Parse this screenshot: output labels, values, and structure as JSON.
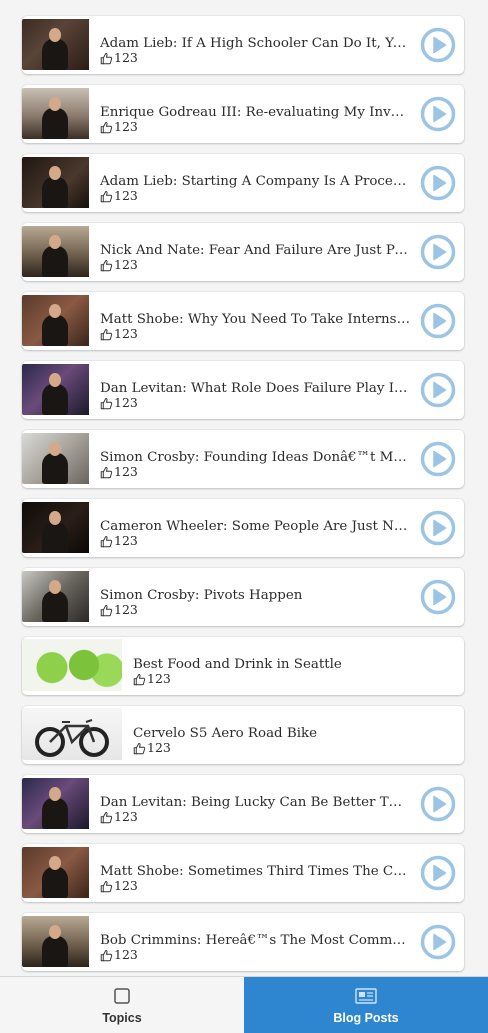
{
  "feed": {
    "items": [
      {
        "title": "Adam Lieb: If A High Schooler Can Do It, You ...",
        "likes": "123",
        "thumb": "t-dark-office",
        "type": "video"
      },
      {
        "title": "Enrique Godreau III: Re-evaluating My Invest...",
        "likes": "123",
        "thumb": "t-two-chairs",
        "type": "video"
      },
      {
        "title": "Adam Lieb: Starting A Company Is A Process ...",
        "likes": "123",
        "thumb": "t-dark-label",
        "type": "video"
      },
      {
        "title": "Nick And Nate: Fear And Failure Are Just Part...",
        "likes": "123",
        "thumb": "t-sofa",
        "type": "video"
      },
      {
        "title": "Matt Shobe: Why You Need To Take Internships",
        "likes": "123",
        "thumb": "t-brick",
        "type": "video"
      },
      {
        "title": "Dan Levitan: What Role Does Failure Play In Y...",
        "likes": "123",
        "thumb": "t-stage",
        "type": "video"
      },
      {
        "title": "Simon Crosby: Founding Ideas Donâ€™t Make ...",
        "likes": "123",
        "thumb": "t-bright",
        "type": "video"
      },
      {
        "title": "Cameron Wheeler: Some People Are Just Not ...",
        "likes": "123",
        "thumb": "t-black",
        "type": "video"
      },
      {
        "title": "Simon Crosby: Pivots Happen",
        "likes": "123",
        "thumb": "t-window",
        "type": "video"
      },
      {
        "title": "Best Food and Drink in Seattle",
        "likes": "123",
        "thumb": "t-limes",
        "type": "post"
      },
      {
        "title": "Cervelo S5 Aero Road Bike",
        "likes": "123",
        "thumb": "t-bike",
        "type": "post"
      },
      {
        "title": "Dan Levitan: Being Lucky Can Be Better Than ...",
        "likes": "123",
        "thumb": "t-stage",
        "type": "video"
      },
      {
        "title": "Matt Shobe: Sometimes Third Times The Char...",
        "likes": "123",
        "thumb": "t-brick",
        "type": "video"
      },
      {
        "title": "Bob Crimmins: Hereâ€™s The Most Common F...",
        "likes": "123",
        "thumb": "t-sofa",
        "type": "video"
      }
    ],
    "icons": {
      "like": "thumbs-up-icon",
      "play": "play-circle-icon"
    }
  },
  "tabbar": {
    "topics_label": "Topics",
    "blog_label": "Blog Posts",
    "active": "blog"
  },
  "colors": {
    "accent": "#2e86d0",
    "play_icon": "#9cc4e4"
  }
}
